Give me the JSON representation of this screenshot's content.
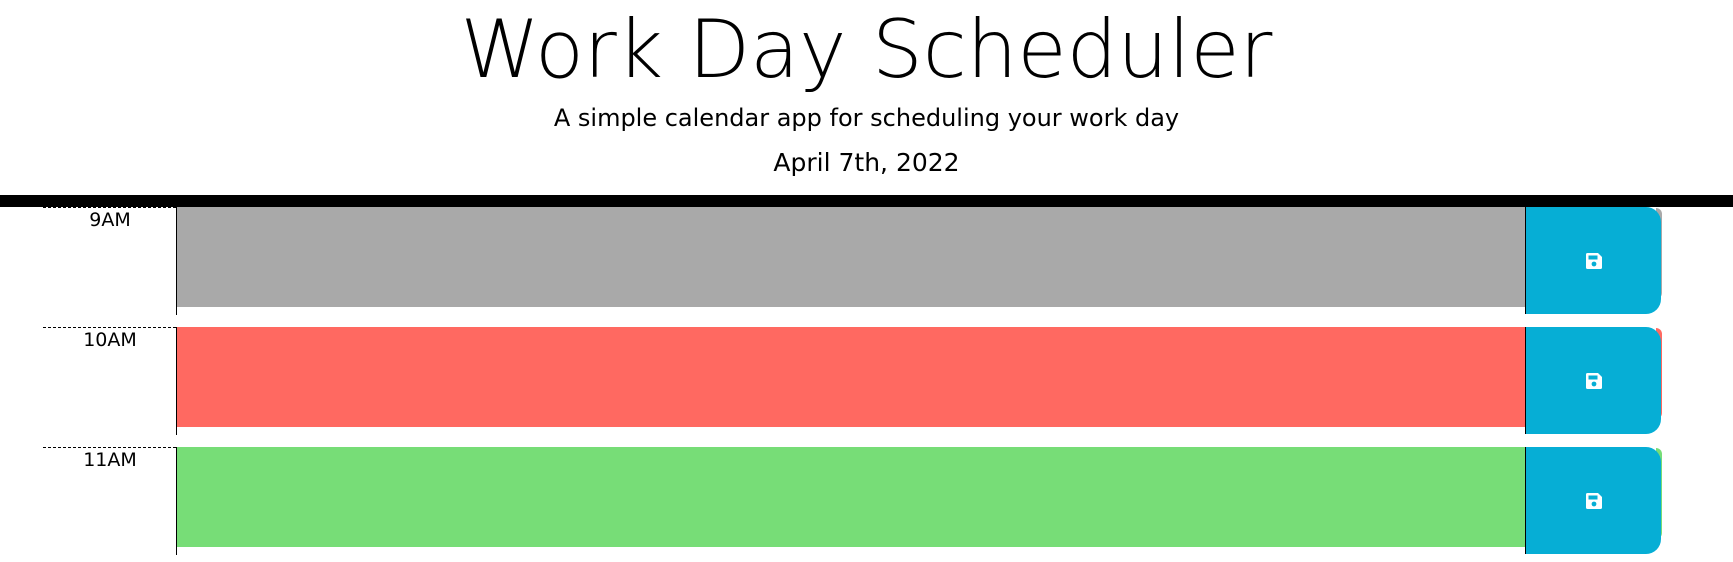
{
  "header": {
    "title": "Work Day Scheduler",
    "subtitle": "A simple calendar app for scheduling your work day",
    "current_date": "April 7th, 2022"
  },
  "rows": [
    {
      "hour": "9AM",
      "text": "",
      "status": "past",
      "color": "#a9a9a9",
      "save_icon": "floppy-disk-icon"
    },
    {
      "hour": "10AM",
      "text": "",
      "status": "present",
      "color": "#ff6961",
      "save_icon": "floppy-disk-icon"
    },
    {
      "hour": "11AM",
      "text": "",
      "status": "future",
      "color": "#77dd77",
      "save_icon": "floppy-disk-icon"
    }
  ],
  "colors": {
    "past": "#a9a9a9",
    "present": "#ff6961",
    "future": "#77dd77",
    "save_button": "#06aed5",
    "divider": "#000000"
  }
}
